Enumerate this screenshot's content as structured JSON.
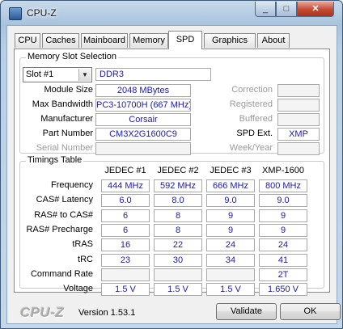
{
  "window": {
    "title": "CPU-Z",
    "min_glyph": "_",
    "max_glyph": "□",
    "close_glyph": "✕"
  },
  "tabs": [
    "CPU",
    "Caches",
    "Mainboard",
    "Memory",
    "SPD",
    "Graphics",
    "About"
  ],
  "active_tab": "SPD",
  "memory_slot": {
    "title": "Memory Slot Selection",
    "slot_selected": "Slot #1",
    "type": "DDR3",
    "labels": {
      "module_size": "Module Size",
      "max_bandwidth": "Max Bandwidth",
      "manufacturer": "Manufacturer",
      "part_number": "Part Number",
      "serial_number": "Serial Number",
      "correction": "Correction",
      "registered": "Registered",
      "buffered": "Buffered",
      "spd_ext": "SPD Ext.",
      "week_year": "Week/Year"
    },
    "values": {
      "module_size": "2048 MBytes",
      "max_bandwidth": "PC3-10700H (667 MHz)",
      "manufacturer": "Corsair",
      "part_number": "CM3X2G1600C9",
      "serial_number": "",
      "correction": "",
      "registered": "",
      "buffered": "",
      "spd_ext": "XMP",
      "week_year": ""
    }
  },
  "timings": {
    "title": "Timings Table",
    "columns": [
      "JEDEC #1",
      "JEDEC #2",
      "JEDEC #3",
      "XMP-1600"
    ],
    "rows": [
      {
        "label": "Frequency",
        "values": [
          "444 MHz",
          "592 MHz",
          "666 MHz",
          "800 MHz"
        ]
      },
      {
        "label": "CAS# Latency",
        "values": [
          "6.0",
          "8.0",
          "9.0",
          "9.0"
        ]
      },
      {
        "label": "RAS# to CAS#",
        "values": [
          "6",
          "8",
          "9",
          "9"
        ]
      },
      {
        "label": "RAS# Precharge",
        "values": [
          "6",
          "8",
          "9",
          "9"
        ]
      },
      {
        "label": "tRAS",
        "values": [
          "16",
          "22",
          "24",
          "24"
        ]
      },
      {
        "label": "tRC",
        "values": [
          "23",
          "30",
          "34",
          "41"
        ]
      },
      {
        "label": "Command Rate",
        "values": [
          "",
          "",
          "",
          "2T"
        ]
      },
      {
        "label": "Voltage",
        "values": [
          "1.5 V",
          "1.5 V",
          "1.5 V",
          "1.650 V"
        ]
      }
    ]
  },
  "footer": {
    "logo": "CPU-Z",
    "version": "Version 1.53.1",
    "validate_label": "Validate",
    "ok_label": "OK"
  }
}
